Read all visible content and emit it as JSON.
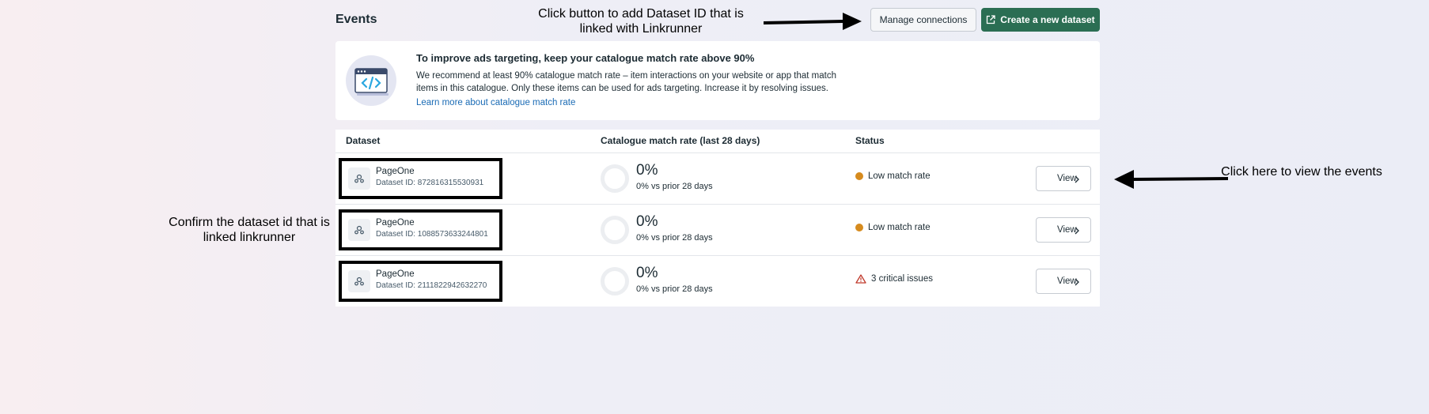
{
  "header": {
    "title": "Events",
    "manage_label": "Manage connections",
    "create_label": "Create a new dataset"
  },
  "banner": {
    "title": "To improve ads targeting, keep your catalogue match rate above 90%",
    "body": "We recommend at least 90% catalogue match rate – item interactions on your website or app that match items in this catalogue. Only these items can be used for ads targeting. Increase it by resolving issues.",
    "link": "Learn more about catalogue match rate",
    "icon": "code-window-icon"
  },
  "table": {
    "columns": [
      "Dataset",
      "Catalogue match rate (last 28 days)",
      "Status"
    ],
    "rows": [
      {
        "name": "PageOne",
        "dataset_id": "Dataset ID: 872816315530931",
        "rate": "0%",
        "rate_sub": "0% vs prior 28 days",
        "status": "Low match rate",
        "status_icon": "warning-dot-icon",
        "view": "View"
      },
      {
        "name": "PageOne",
        "dataset_id": "Dataset ID: 1088573633244801",
        "rate": "0%",
        "rate_sub": "0% vs prior 28 days",
        "status": "Low match rate",
        "status_icon": "warning-dot-icon",
        "view": "View"
      },
      {
        "name": "PageOne",
        "dataset_id": "Dataset ID: 2111822942632270",
        "rate": "0%",
        "rate_sub": "0% vs prior 28 days",
        "status": "3 critical issues",
        "status_icon": "alert-triangle-icon",
        "view": "View"
      }
    ]
  },
  "annotations": {
    "top": "Click button to add Dataset ID that is linked with Linkrunner",
    "left": "Confirm the dataset id that is linked linkrunner",
    "right": "Click here to view the events"
  },
  "colors": {
    "primary_green": "#2b6e53",
    "warning": "#d68b1e",
    "critical": "#c0392b",
    "link": "#1a6bb5"
  }
}
